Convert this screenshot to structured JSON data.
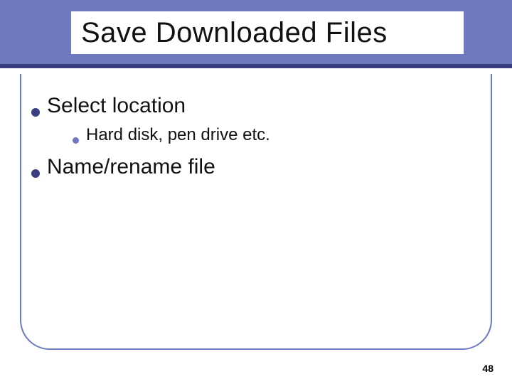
{
  "title": "Save Downloaded Files",
  "bullets": {
    "item1": "Select  location",
    "item1_sub1": "Hard disk, pen drive etc.",
    "item2": "Name/rename file"
  },
  "page_number": "48"
}
